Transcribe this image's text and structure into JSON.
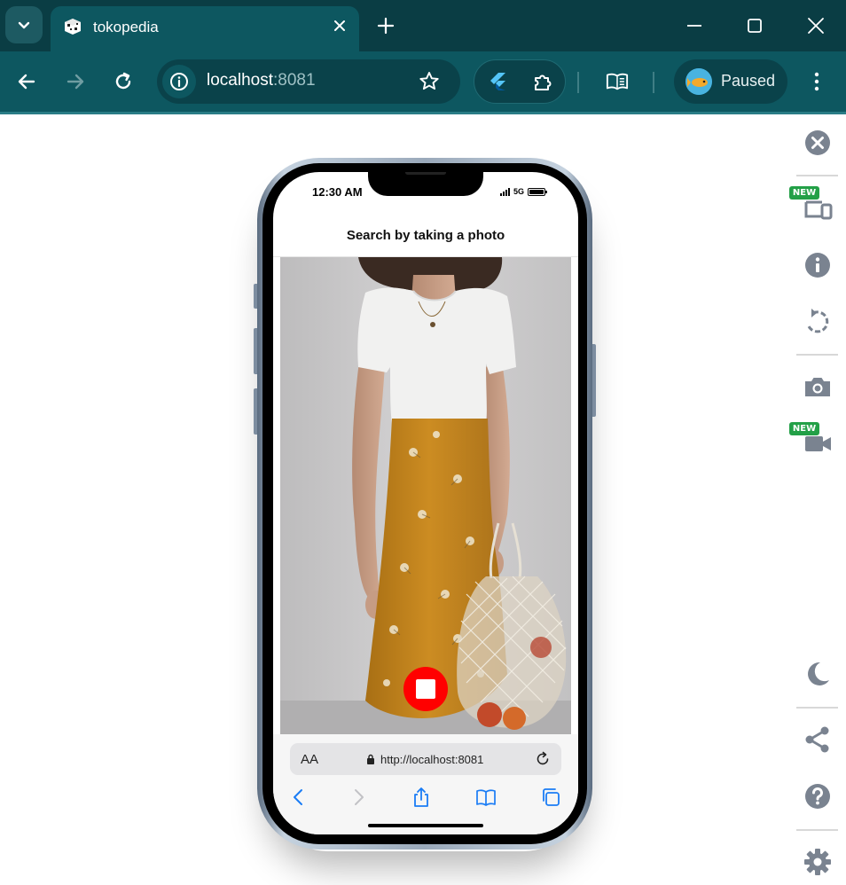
{
  "browser": {
    "tab_title": "tokopedia",
    "url_host": "localhost",
    "url_port": ":8081",
    "profile_label": "Paused",
    "accent": "#0d5760"
  },
  "side_panel": {
    "new_badge": "NEW",
    "icons": [
      "close-icon",
      "device-frame-icon",
      "info-icon",
      "rotate-icon",
      "camera-icon",
      "video-record-icon",
      "dark-mode-icon",
      "share-icon",
      "help-icon",
      "settings-icon"
    ]
  },
  "phone": {
    "status_time": "12:30 AM",
    "network": "5G",
    "battery_level": 1.0,
    "screen_title": "Search by taking a photo",
    "safari": {
      "text_size_label": "AA",
      "url": "http://localhost:8081"
    },
    "shutter_color": "#ff0000"
  }
}
